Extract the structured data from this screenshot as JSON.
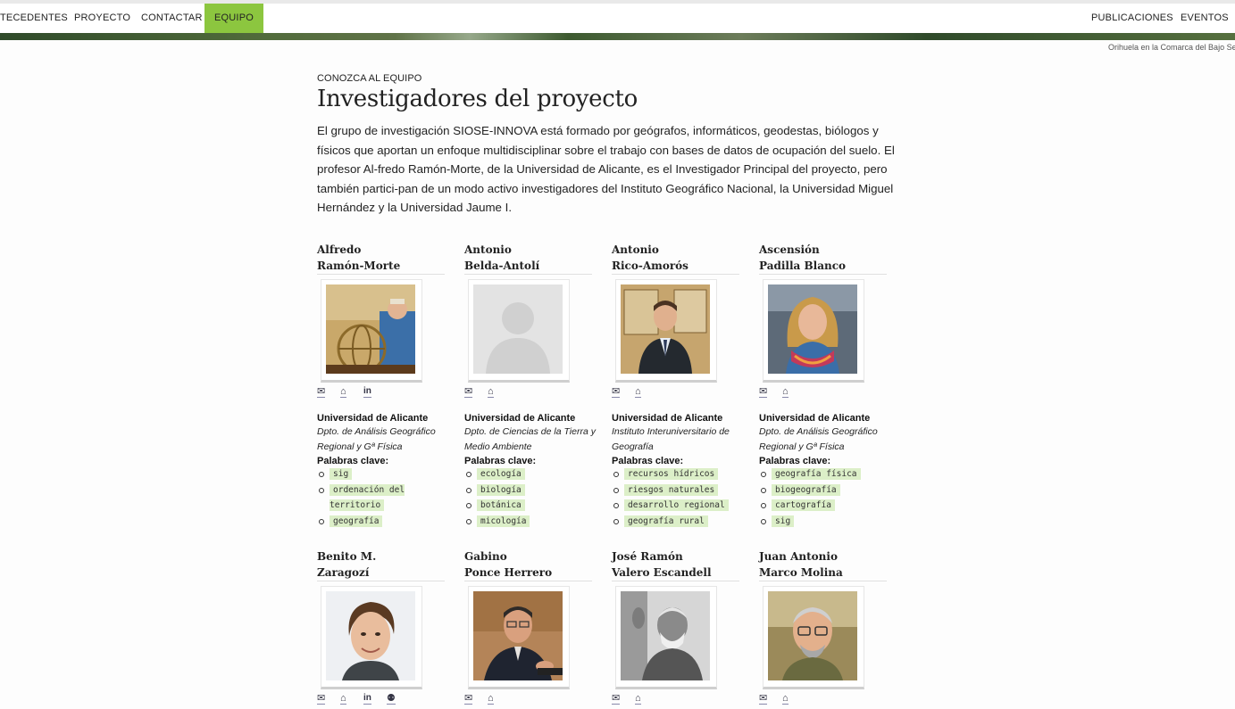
{
  "nav": {
    "left": [
      "TECEDENTES",
      "PROYECTO",
      "CONTACTAR",
      "EQUIPO"
    ],
    "right": [
      "PUBLICACIONES",
      "EVENTOS"
    ]
  },
  "banner": {
    "caption": "Orihuela en la Comarca del Bajo Segu"
  },
  "header": {
    "eyebrow": "CONOZCA AL EQUIPO",
    "title": "Investigadores del proyecto",
    "intro": "El grupo de investigación SIOSE-INNOVA está formado por geógrafos, informáticos, geodestas, biólogos y físicos que aportan un enfoque multidisciplinar sobre el trabajo con bases de datos de ocupación del suelo. El profesor Al-fredo Ramón-Morte, de la Universidad de Alicante, es el Investigador Principal del proyecto, pero también partici-pan de un modo activo investigadores del Instituto Geográfico Nacional, la Universidad Miguel Hernández y la Universidad Jaume I."
  },
  "people": [
    {
      "first": "Alfredo",
      "last": "Ramón-Morte",
      "photo": "man-globe",
      "icons": [
        "mail-icon",
        "home-icon",
        "linkedin-icon"
      ],
      "university": "Universidad de Alicante",
      "dept": "Dpto. de Análisis Geográfico Regional y Gª Física",
      "kw_label": "Palabras clave:",
      "keywords": [
        "sig",
        "ordenación del territorio",
        "geografía"
      ]
    },
    {
      "first": "Antonio",
      "last": "Belda-Antolí",
      "photo": "placeholder",
      "icons": [
        "mail-icon",
        "home-icon"
      ],
      "university": "Universidad de Alicante",
      "dept": "Dpto. de Ciencias de la Tierra y Medio Ambiente",
      "kw_label": "Palabras clave:",
      "keywords": [
        "ecología",
        "biología",
        "botánica",
        "micología"
      ]
    },
    {
      "first": "Antonio",
      "last": "Rico-Amorós",
      "photo": "man-suit",
      "icons": [
        "mail-icon",
        "home-icon"
      ],
      "university": "Universidad de Alicante",
      "dept": "Instituto Interuniversitario de Geografía",
      "kw_label": "Palabras clave:",
      "keywords": [
        "recursos hídricos",
        "riesgos naturales",
        "desarrollo regional",
        "geografía rural"
      ]
    },
    {
      "first": "Ascensión",
      "last": "Padilla Blanco",
      "photo": "woman",
      "icons": [
        "mail-icon",
        "home-icon"
      ],
      "university": "Universidad de Alicante",
      "dept": "Dpto. de Análisis Geográfico Regional y Gª Física",
      "kw_label": "Palabras clave:",
      "keywords": [
        "geografía física",
        "biogeografía",
        "cartografía",
        "sig"
      ]
    },
    {
      "first": "Benito M.",
      "last": "Zaragozí",
      "photo": "young-man",
      "icons": [
        "mail-icon",
        "home-icon",
        "linkedin-icon",
        "github-icon"
      ]
    },
    {
      "first": "Gabino",
      "last": "Ponce Herrero",
      "photo": "man-talking",
      "icons": [
        "mail-icon",
        "home-icon"
      ]
    },
    {
      "first": "José Ramón",
      "last": "Valero Escandell",
      "photo": "bw-man",
      "icons": [
        "mail-icon",
        "home-icon"
      ]
    },
    {
      "first": "Juan Antonio",
      "last": "Marco Molina",
      "photo": "man-glasses",
      "icons": [
        "mail-icon",
        "home-icon"
      ]
    }
  ]
}
